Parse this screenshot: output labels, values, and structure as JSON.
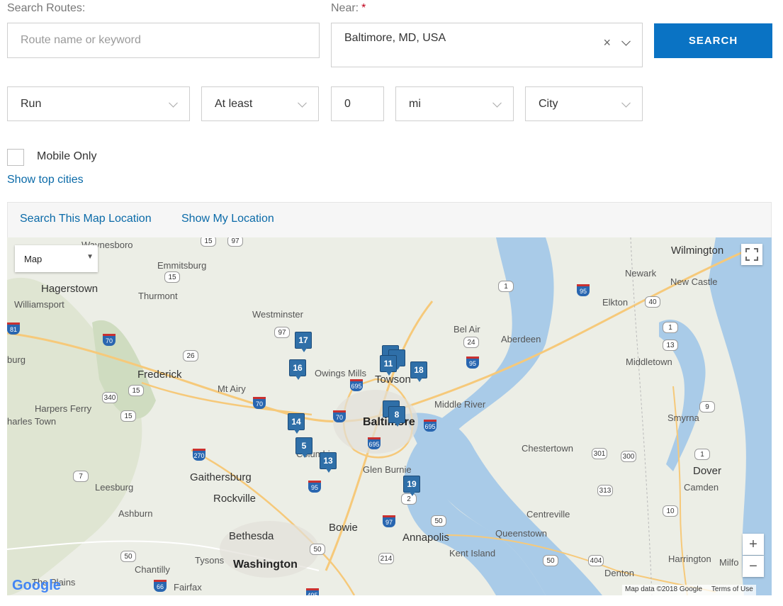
{
  "search_routes": {
    "label": "Search Routes:",
    "placeholder": "Route name or keyword",
    "value": ""
  },
  "near": {
    "label": "Near:",
    "required_mark": "*",
    "value": "Baltimore, MD, USA"
  },
  "search_button": {
    "label": "SEARCH"
  },
  "filters": {
    "activity": "Run",
    "comparator": "At least",
    "distance": "0",
    "unit": "mi",
    "scope": "City"
  },
  "mobile_only": {
    "label": "Mobile Only",
    "checked": false
  },
  "show_top_cities": "Show top cities",
  "map_toolbar": {
    "search_location": "Search This Map Location",
    "show_my_location": "Show My Location"
  },
  "map": {
    "type_selector": "Map",
    "zoom_in": "+",
    "zoom_out": "−",
    "attribution": "Map data ©2018 Google",
    "terms": "Terms of Use",
    "logo": "Google",
    "places": {
      "waynesboro": "Waynesboro",
      "emmitsburg": "Emmitsburg",
      "hagerstown": "Hagerstown",
      "thurmont": "Thurmont",
      "williamsport": "Williamsport",
      "westminster": "Westminster",
      "bel_air": "Bel Air",
      "aberdeen": "Aberdeen",
      "elkton": "Elkton",
      "newark": "Newark",
      "wilmington": "Wilmington",
      "new_castle": "New Castle",
      "middletown": "Middletown",
      "frederick": "Frederick",
      "owings_mills": "Owings Mills",
      "towson": "Towson",
      "mt_airy": "Mt Airy",
      "harpers_ferry": "Harpers Ferry",
      "charles_town": "harles Town",
      "middle_river": "Middle River",
      "baltimore": "Baltimore",
      "smyrna": "Smyrna",
      "columbia": "Columbia",
      "chestertown": "Chestertown",
      "gaithersburg": "Gaithersburg",
      "glen_burnie": "Glen Burnie",
      "dover": "Dover",
      "leesburg": "Leesburg",
      "rockville": "Rockville",
      "camden": "Camden",
      "ashburn": "Ashburn",
      "centreville": "Centreville",
      "bowie": "Bowie",
      "bethesda": "Bethesda",
      "annapolis": "Annapolis",
      "queenstown": "Queenstown",
      "tysons": "Tysons",
      "washington": "Washington",
      "kent_island": "Kent Island",
      "harrington": "Harrington",
      "milford": "Milfo",
      "chantilly": "Chantilly",
      "fairfax": "Fairfax",
      "denton": "Denton",
      "the_plains": "The Plains",
      "burg": "burg"
    },
    "markers": [
      "17",
      "16",
      "11",
      "18",
      "8",
      "14",
      "5",
      "13",
      "19"
    ],
    "roads": [
      "15",
      "97",
      "15",
      "1",
      "95",
      "40",
      "70",
      "81",
      "97",
      "24",
      "95",
      "1",
      "13",
      "26",
      "695",
      "340",
      "15",
      "70",
      "70",
      "695",
      "9",
      "15",
      "270",
      "695",
      "301",
      "300",
      "1",
      "7",
      "95",
      "313",
      "2",
      "97",
      "50",
      "10",
      "50",
      "214",
      "50",
      "404",
      "50",
      "66",
      "495"
    ]
  }
}
